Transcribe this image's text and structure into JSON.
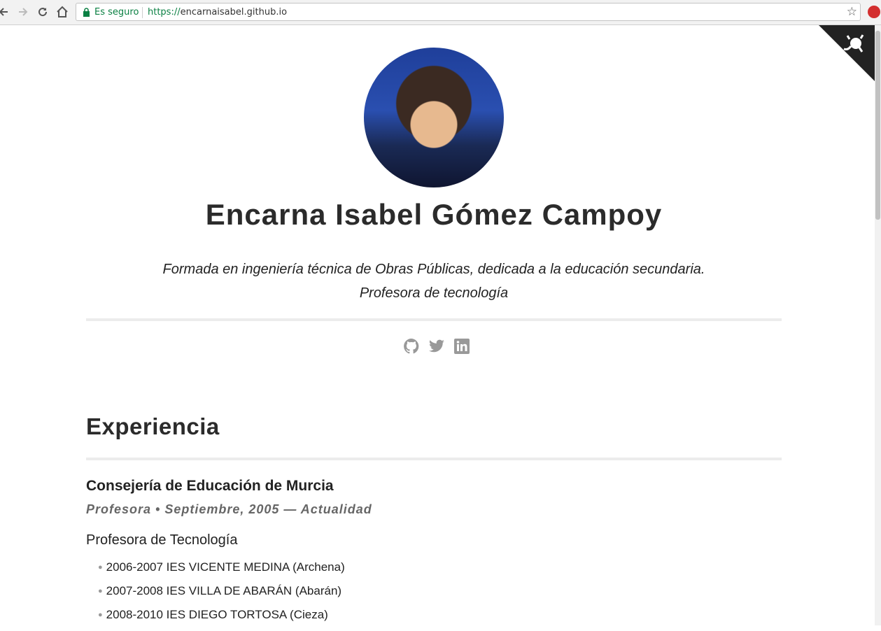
{
  "browser": {
    "secure_label": "Es seguro",
    "url_scheme": "https://",
    "url_host": "encarnaisabel.github.io"
  },
  "profile": {
    "name": "Encarna Isabel Gómez Campoy",
    "tagline_line1": "Formada en ingeniería técnica de Obras Públicas, dedicada a la educación secundaria.",
    "tagline_line2": "Profesora de tecnología"
  },
  "social_icons": [
    "github-icon",
    "twitter-icon",
    "linkedin-icon"
  ],
  "experience": {
    "heading": "Experiencia",
    "employer": "Consejería de Educación de Murcia",
    "role_line": "Profesora • Septiembre, 2005 — Actualidad",
    "subtitle": "Profesora de Tecnología",
    "positions": [
      "2006-2007 IES VICENTE MEDINA (Archena)",
      "2007-2008 IES VILLA DE ABARÁN (Abarán)",
      "2008-2010 IES DIEGO TORTOSA (Cieza)"
    ]
  },
  "colors": {
    "secure_green": "#0b8043",
    "text": "#222222",
    "muted": "#666666"
  }
}
